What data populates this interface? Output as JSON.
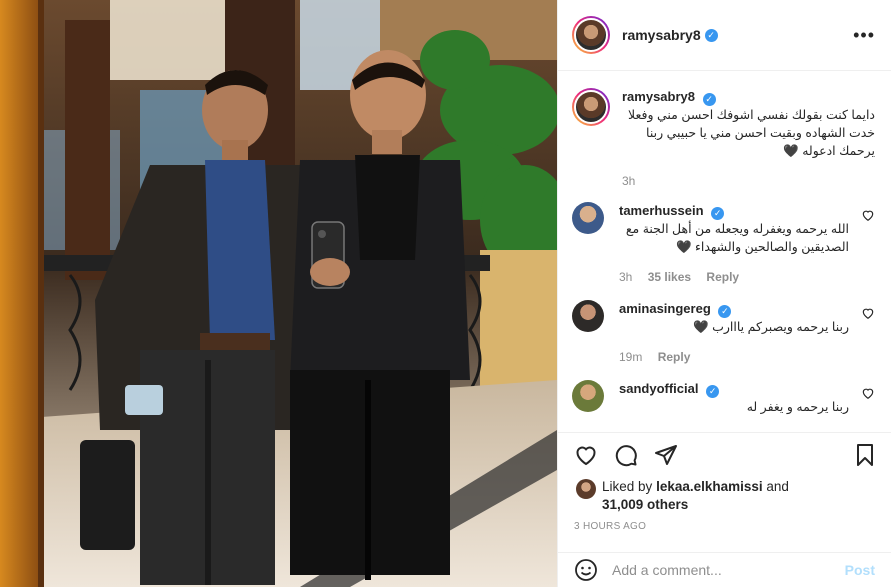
{
  "post": {
    "username": "ramysabry8",
    "more_label": "•••"
  },
  "caption": {
    "username": "ramysabry8",
    "text": "دايما كنت بقولك نفسي اشوفك احسن مني وفعلا خدت الشهاده وبقيت احسن مني يا حبيبي ربنا يرحمك ادعوله 🖤",
    "time": "3h"
  },
  "comments": [
    {
      "username": "tamerhussein",
      "verified": true,
      "text": "الله يرحمه ويغفرله ويجعله من أهل الجنة مع الصديقين والصالحين والشهداء 🖤",
      "time": "3h",
      "likes": "35 likes",
      "reply": "Reply",
      "avatar_color": "#3d5a8a"
    },
    {
      "username": "aminasingereg",
      "verified": true,
      "text": "ربنا يرحمه ويصبركم يااارب 🖤",
      "time": "19m",
      "likes": "",
      "reply": "Reply",
      "avatar_color": "#2d2a28"
    },
    {
      "username": "sandyofficial",
      "verified": true,
      "text": "ربنا يرحمه و يغفر له",
      "time": "",
      "likes": "",
      "reply": "",
      "avatar_color": "#6b7a3a"
    }
  ],
  "likes_section": {
    "prefix": "Liked by",
    "liker": "lekaa.elkhamissi",
    "joiner": "and",
    "others": "31,009 others"
  },
  "timestamp": "3 HOURS AGO",
  "add_comment": {
    "placeholder": "Add a comment...",
    "post_label": "Post"
  },
  "colors": {
    "verified": "#3897f0",
    "post_disabled": "#b2dffc",
    "secondary_text": "#8e8e8e"
  }
}
